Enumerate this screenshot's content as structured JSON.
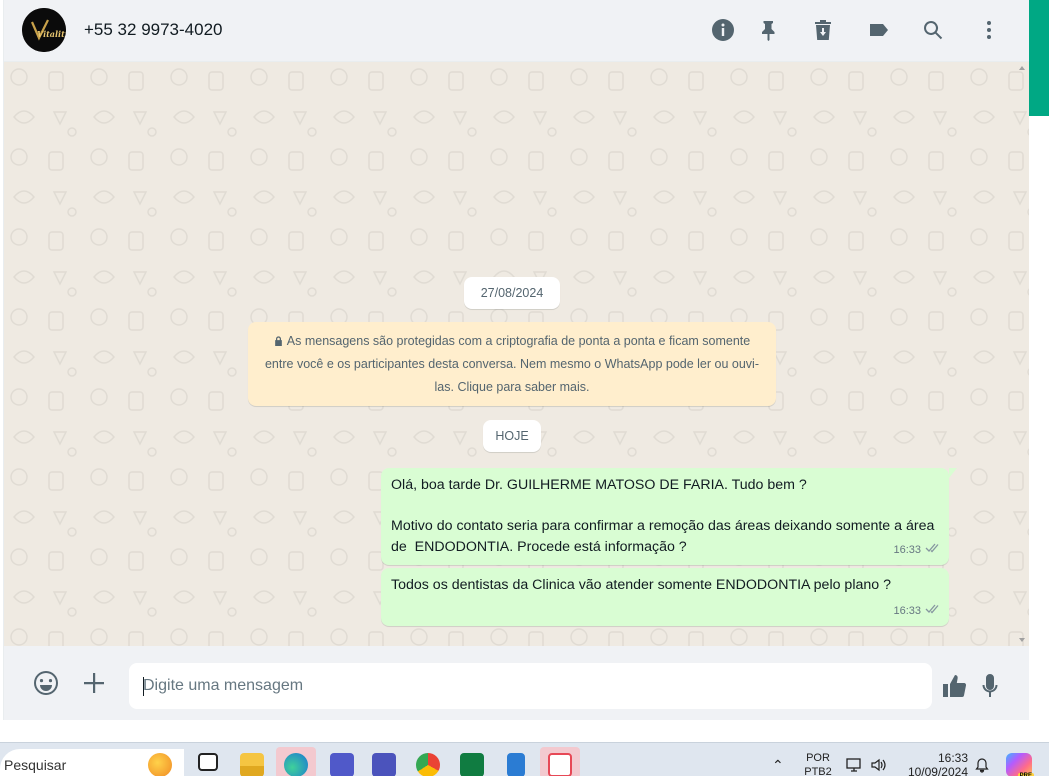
{
  "header": {
    "avatar_text": "Vitality",
    "contact_name": "+55 32 9973-4020",
    "icons": [
      "info-icon",
      "pin-icon",
      "trash-icon",
      "label-icon",
      "search-icon",
      "more-vertical-icon"
    ]
  },
  "chat": {
    "date_chip_1": "27/08/2024",
    "encryption_notice": "As mensagens são protegidas com a criptografia de ponta a ponta e ficam somente entre você e os participantes desta conversa. Nem mesmo o WhatsApp pode ler ou ouvi-las. Clique para saber mais.",
    "date_chip_2": "HOJE",
    "messages": [
      {
        "text": "Olá, boa tarde Dr. GUILHERME MATOSO DE FARIA. Tudo bem ?\n\nMotivo do contato seria para confirmar a remoção das áreas deixando somente a área de  ENDODONTIA. Procede está informação ?",
        "time": "16:33",
        "status": "read-ticks"
      },
      {
        "text": "Todos os dentistas da Clinica vão atender somente ENDODONTIA pelo plano ?",
        "time": "16:33",
        "status": "read-ticks"
      }
    ]
  },
  "composer": {
    "placeholder": "Digite uma mensagem",
    "icons": [
      "emoji-icon",
      "plus-icon",
      "thumbs-up-icon",
      "microphone-icon"
    ]
  },
  "taskbar": {
    "search_text": "Pesquisar",
    "apps": [
      "widgets",
      "task-view",
      "file-explorer",
      "edge",
      "teams",
      "teams-classic",
      "chrome",
      "excel",
      "notepad",
      "snipping-tool"
    ],
    "lang_line1": "POR",
    "lang_line2": "PTB2",
    "time": "16:33",
    "date": "10/09/2024"
  },
  "colors": {
    "accent": "#00a884",
    "outgoing_bubble": "#d9fdd3",
    "notice_bg": "#ffeecd",
    "chat_bg": "#efeae2",
    "tick_color": "#667781"
  }
}
